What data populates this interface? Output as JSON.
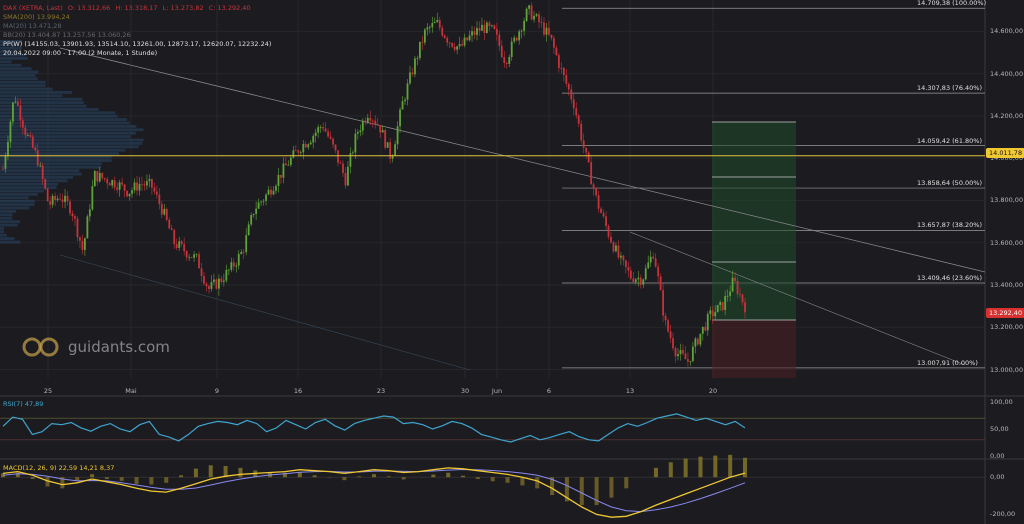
{
  "header": {
    "symbol_line": {
      "name": "DAX (XETRA, Last)",
      "o": "O: 13.312,66",
      "h": "H: 13.318,17",
      "l": "L: 13.273,82",
      "c": "C: 13.292,40"
    },
    "sma200": "SMA(200)  13.994,24",
    "line2": "MA(20)  13.471,28",
    "bbands": "BB(20)  13.404,87  13.257,56  13.060,26",
    "pp_line": "PP(W)  (14155.03, 13901.93, 13514.10, 13261.00, 12873.17, 12620.07, 12232.24)",
    "time_line": "20.04.2022 09:00 - 17:00  (2 Monate, 1 Stunde)"
  },
  "logo": {
    "text": "guidants.com"
  },
  "colors": {
    "background": "#1c1c20",
    "up": "#5fa33a",
    "down": "#c8323a",
    "fib": "#9a9a9a",
    "sma": "#e2c43a",
    "rsi": "#3fa5cf",
    "macd": "#f0c832",
    "signal": "#8a8af0",
    "price_badge": "#d93030",
    "sma_badge": "#f0c832"
  },
  "chart_data": [
    {
      "type": "candlestick",
      "title": "",
      "x_ticks": [
        "25",
        "Mai",
        "9",
        "16",
        "23",
        "30",
        "Jun",
        "6",
        "13",
        "20"
      ],
      "y_ticks": [
        "14.800,00",
        "14.600,00",
        "14.400,00",
        "14.200,00",
        "14.000,00",
        "13.800,00",
        "13.600,00",
        "13.400,00",
        "13.200,00",
        "13.000,00"
      ],
      "ylim": [
        12960,
        14720
      ],
      "last_price": "13.292,40",
      "sma200_value": "14.011,78",
      "fibonacci": [
        {
          "label": "14.709,38 (100.00%)",
          "value": 14709.38
        },
        {
          "label": "14.307,83 (76.40%)",
          "value": 14307.83
        },
        {
          "label": "14.059,42 (61.80%)",
          "value": 14059.42
        },
        {
          "label": "13.858,64 (50.00%)",
          "value": 13858.64
        },
        {
          "label": "13.657,87 (38.20%)",
          "value": 13657.87
        },
        {
          "label": "13.409,46 (23.60%)",
          "value": 13409.46
        },
        {
          "label": "13.007,91 (0.00%)",
          "value": 13007.91
        }
      ],
      "path": [
        13950,
        14300,
        14120,
        14000,
        13780,
        13820,
        13760,
        13560,
        13920,
        13900,
        13880,
        13840,
        13880,
        13870,
        13750,
        13600,
        13560,
        13520,
        13380,
        13420,
        13480,
        13560,
        13760,
        13820,
        13900,
        13980,
        14050,
        14100,
        14160,
        14040,
        13900,
        14120,
        14220,
        14150,
        14000,
        14260,
        14440,
        14600,
        14640,
        14560,
        14520,
        14580,
        14620,
        14600,
        14460,
        14580,
        14700,
        14640,
        14560,
        14400,
        14260,
        14020,
        13800,
        13650,
        13520,
        13440,
        13430,
        13560,
        13220,
        13080,
        13040,
        13160,
        13260,
        13300,
        13420,
        13300
      ]
    },
    {
      "type": "line",
      "title": "RSI(7)  47,89",
      "y_ticks": [
        "100,00",
        "50,00",
        "0,00"
      ],
      "ylim": [
        0,
        100
      ],
      "values": [
        55,
        72,
        68,
        40,
        45,
        60,
        58,
        62,
        52,
        46,
        55,
        60,
        50,
        45,
        58,
        64,
        40,
        35,
        28,
        40,
        55,
        60,
        64,
        62,
        58,
        66,
        60,
        45,
        52,
        66,
        58,
        50,
        62,
        68,
        56,
        48,
        60,
        66,
        70,
        74,
        72,
        60,
        62,
        58,
        50,
        56,
        64,
        60,
        52,
        40,
        35,
        30,
        26,
        32,
        38,
        30,
        34,
        40,
        45,
        36,
        30,
        28,
        40,
        52,
        60,
        55,
        62,
        70,
        74,
        78,
        72,
        66,
        70,
        64,
        58,
        64,
        52
      ]
    },
    {
      "type": "line",
      "title": "MACD(12, 26, 9)  22,59  14,21  8,37",
      "y_ticks": [
        "0,00",
        "-200,00"
      ],
      "ylim": [
        -230,
        60
      ],
      "macd": [
        20,
        30,
        10,
        -20,
        -40,
        -30,
        -10,
        -25,
        -40,
        -60,
        -75,
        -80,
        -60,
        -35,
        -10,
        5,
        15,
        20,
        25,
        30,
        40,
        35,
        30,
        20,
        30,
        40,
        35,
        25,
        30,
        40,
        50,
        45,
        35,
        25,
        15,
        0,
        -20,
        -60,
        -110,
        -160,
        -200,
        -215,
        -210,
        -185,
        -150,
        -120,
        -90,
        -60,
        -30,
        0,
        22
      ],
      "signal": [
        10,
        18,
        15,
        5,
        -10,
        -20,
        -18,
        -20,
        -30,
        -42,
        -55,
        -65,
        -65,
        -58,
        -42,
        -25,
        -10,
        2,
        12,
        18,
        26,
        30,
        31,
        28,
        28,
        32,
        33,
        31,
        30,
        33,
        38,
        41,
        40,
        36,
        30,
        22,
        10,
        -12,
        -45,
        -85,
        -125,
        -160,
        -180,
        -185,
        -175,
        -160,
        -140,
        -115,
        -88,
        -60,
        -30
      ]
    }
  ]
}
